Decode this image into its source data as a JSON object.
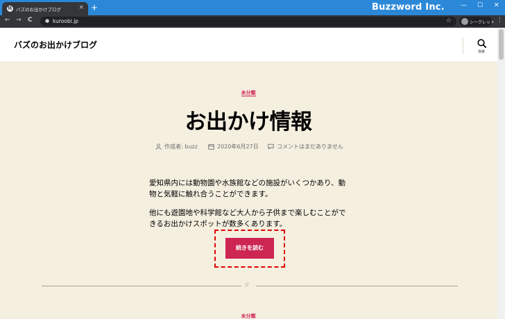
{
  "browser": {
    "tab_title": "バズのお出かけブログ",
    "tab_close": "×",
    "new_tab": "+",
    "brand": "Buzzword Inc.",
    "window_minimize": "—",
    "window_maximize": "☐",
    "window_close": "✕",
    "back": "←",
    "forward": "→",
    "reload": "C",
    "lock": "🔒",
    "url": "kuroobi.jp",
    "bookmark_star": "☆",
    "incognito_label": "シークレット",
    "menu": "⋮"
  },
  "site": {
    "title": "バズのお出かけブログ",
    "search_label": "検索"
  },
  "post": {
    "category": "未分類",
    "title": "お出かけ情報",
    "meta": {
      "author": "作成者: buzz",
      "date": "2020年6月27日",
      "comments": "コメントはまだありません"
    },
    "paragraphs": [
      "愛知県内には動物園や水族館などの施設がいくつかあり、動物と気軽に触れ合うことができます。",
      "他にも遊園地や科学館など大人から子供まで楽しむことができるお出かけスポットが数多くあります。"
    ],
    "read_more": "続きを読む"
  },
  "separator": "//",
  "next_post": {
    "category": "未分類"
  },
  "colors": {
    "accent": "#cd2653",
    "background": "#f5efe0",
    "titlebar": "#2b88d8",
    "highlight_frame": "#e00000"
  }
}
